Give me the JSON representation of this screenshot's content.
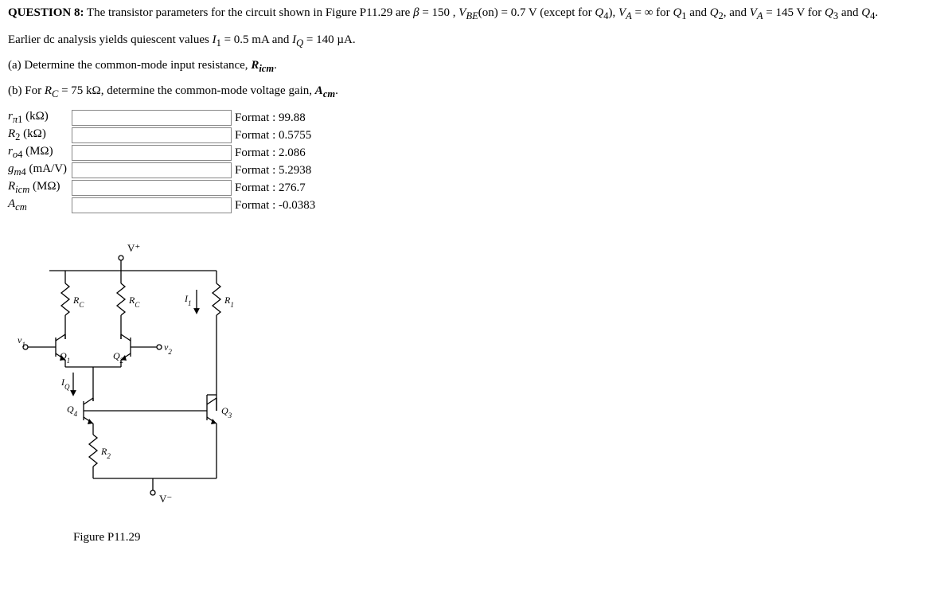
{
  "question_label": "QUESTION 8:",
  "question_text": " The transistor parameters for the circuit shown in Figure P11.29 are β = 150 , V_BE(on) = 0.7 V (except for Q₄), V_A = ∞ for Q₁ and Q₂, and V_A = 145 V for Q₃ and Q₄.",
  "earlier_line": "Earlier dc analysis yields quiescent values I₁ = 0.5 mA and I_Q = 140 µA.",
  "part_a": "(a) Determine the common-mode input resistance, R_icm.",
  "part_b": "(b) For R_C = 75 kΩ, determine the common-mode voltage gain, A_cm.",
  "rows": [
    {
      "label_html": "<i>r</i><sub><i>π</i>1</sub> (kΩ)",
      "format": "Format : 99.88"
    },
    {
      "label_html": "<i>R</i><sub>2</sub> (kΩ)",
      "format": "Format : 0.5755"
    },
    {
      "label_html": "<i>r</i><sub><i>o</i>4</sub> (MΩ)",
      "format": "Format : 2.086"
    },
    {
      "label_html": "<i>g</i><sub><i>m</i>4</sub> (mA/V)",
      "format": "Format : 5.2938"
    },
    {
      "label_html": "<i>R</i><sub><i>icm</i></sub> (MΩ)",
      "format": "Format : 276.7"
    },
    {
      "label_html": "<i>A</i><sub><i>cm</i></sub>",
      "format": "Format : -0.0383"
    }
  ],
  "figure_caption": "Figure P11.29",
  "fig": {
    "Vplus": "V⁺",
    "Vminus": "V⁻",
    "RC1": "R_C",
    "RC2": "R_C",
    "R1": "R₁",
    "R2": "R₂",
    "I1": "I₁",
    "IQ": "I_Q",
    "Q1": "Q₁",
    "Q2": "Q₂",
    "Q3": "Q₃",
    "Q4": "Q₄",
    "v1": "v₁",
    "v2": "v₂"
  }
}
